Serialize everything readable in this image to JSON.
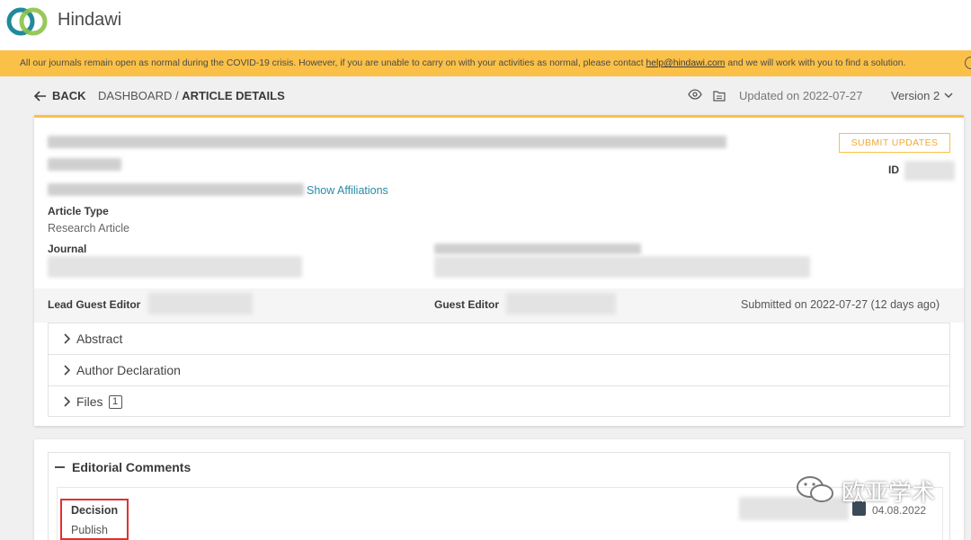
{
  "brand": {
    "name": "Hindawi"
  },
  "banner": {
    "text_before": "All our journals remain open as normal during the COVID-19 crisis. However, if you are unable to carry on with your activities as normal, please contact ",
    "link": "help@hindawi.com",
    "text_after": " and we will work with you to find a solution."
  },
  "nav": {
    "back_label": "BACK",
    "crumb_parent": "DASHBOARD / ",
    "crumb_current": "ARTICLE DETAILS",
    "updated": "Updated on 2022-07-27",
    "version": "Version 2"
  },
  "article": {
    "submit_label": "SUBMIT UPDATES",
    "id_label": "ID",
    "show_affiliations": "Show Affiliations",
    "type_label": "Article Type",
    "type_value": "Research Article",
    "journal_label": "Journal"
  },
  "editors": {
    "lead_label": "Lead Guest Editor",
    "guest_label": "Guest Editor",
    "submitted": "Submitted on 2022-07-27 (12 days ago)"
  },
  "accordion": [
    {
      "label": "Abstract"
    },
    {
      "label": "Author Declaration"
    },
    {
      "label": "Files",
      "count": "1"
    }
  ],
  "editorial": {
    "title": "Editorial Comments",
    "decision_label": "Decision",
    "decision_value": "Publish",
    "date": "04.08.2022"
  },
  "watermark": {
    "text": "欧亚学术"
  },
  "colors": {
    "accent": "#fbc047",
    "link": "#2a8aa8",
    "highlight": "#e23030"
  },
  "icons": [
    "hindawi-logo-icon",
    "back-arrow-icon",
    "eye-icon",
    "folder-icon",
    "chevron-down-icon",
    "chevron-right-icon",
    "minus-icon",
    "calendar-icon",
    "wechat-icon"
  ]
}
